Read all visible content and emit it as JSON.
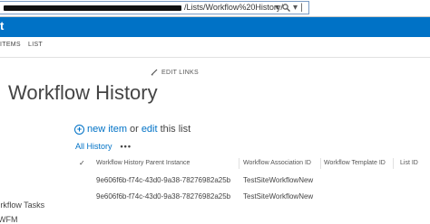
{
  "browser": {
    "url_visible_text": "/Lists/Workflow%20History/",
    "url_suffix": "▾",
    "refresh_glyph": "↻",
    "separator": "|"
  },
  "ribbon": {
    "tabs": [
      "ITEMS",
      "LIST"
    ]
  },
  "page": {
    "edit_links_label": "EDIT LINKS",
    "title": "Workflow History"
  },
  "left_nav": {
    "items": [
      "Workflow Tasks",
      "WFM"
    ]
  },
  "list_actions": {
    "plus_glyph": "+",
    "new_item": "new item",
    "or": "or",
    "edit": "edit",
    "this_list": "this list"
  },
  "views": {
    "current": "All History",
    "more": "•••"
  },
  "table": {
    "check_glyph": "✓",
    "columns": [
      "Workflow History Parent Instance",
      "Workflow Association ID",
      "Workflow Template ID",
      "List ID"
    ],
    "rows": [
      [
        "9e606f6b-f74c-43d0-9a38-78276982a25b",
        "TestSiteWorkflowNew",
        "",
        ""
      ],
      [
        "9e606f6b-f74c-43d0-9a38-78276982a25b",
        "TestSiteWorkflowNew",
        "",
        ""
      ]
    ]
  },
  "colors": {
    "suite_bar": "#0072c6",
    "link": "#0072c6",
    "text": "#444444"
  }
}
